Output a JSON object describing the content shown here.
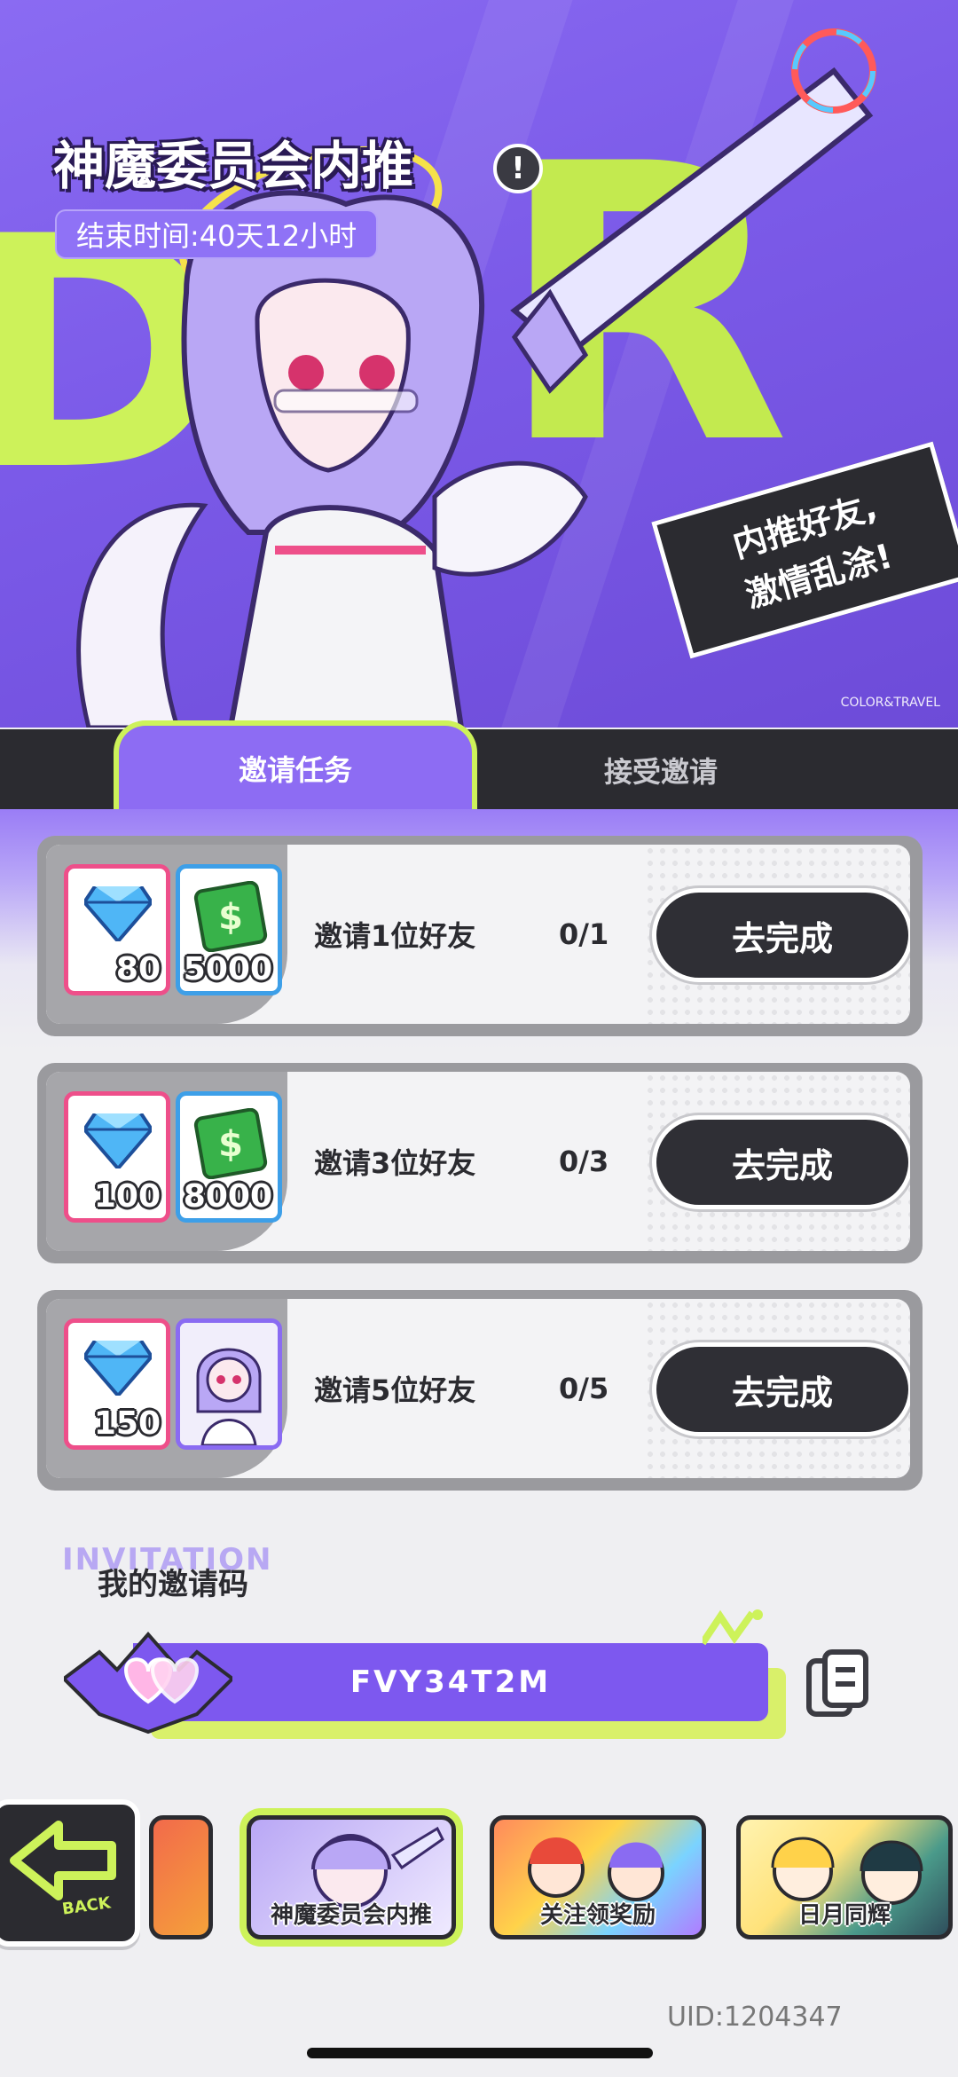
{
  "hero": {
    "title": "神魔委员会内推",
    "info_icon": "exclamation-icon",
    "end_time": "结束时间:40天12小时",
    "slogan_line1": "内推好友,",
    "slogan_line2": "激情乱涂!",
    "brand_text": "COLOR&TRAVEL"
  },
  "tabs": [
    {
      "label": "邀请任务",
      "active": true
    },
    {
      "label": "接受邀请",
      "active": false
    }
  ],
  "tasks": [
    {
      "label": "邀请1位好友",
      "progress": "0/1",
      "button": "去完成",
      "rewards": [
        {
          "icon": "diamond-icon",
          "amount": "80"
        },
        {
          "icon": "cash-icon",
          "amount": "5000"
        }
      ]
    },
    {
      "label": "邀请3位好友",
      "progress": "0/3",
      "button": "去完成",
      "rewards": [
        {
          "icon": "diamond-icon",
          "amount": "100"
        },
        {
          "icon": "cash-icon",
          "amount": "8000"
        }
      ]
    },
    {
      "label": "邀请5位好友",
      "progress": "0/5",
      "button": "去完成",
      "rewards": [
        {
          "icon": "diamond-icon",
          "amount": "150"
        },
        {
          "icon": "character-card-icon",
          "amount": ""
        }
      ]
    }
  ],
  "invite": {
    "bg_text": "INVITATION",
    "title": "我的邀请码",
    "code": "FVY34T2M",
    "copy_icon": "copy-icon"
  },
  "nav": {
    "back_label": "BACK",
    "banners": [
      "神魔委员会内推",
      "关注领奖励",
      "日月同辉"
    ]
  },
  "uid": "UID:1204347",
  "colors": {
    "accent_purple": "#8d6cf3",
    "lime": "#cdf25a",
    "dark": "#2b2b30",
    "pink": "#ee4f8a",
    "blue": "#3d9fe8"
  }
}
